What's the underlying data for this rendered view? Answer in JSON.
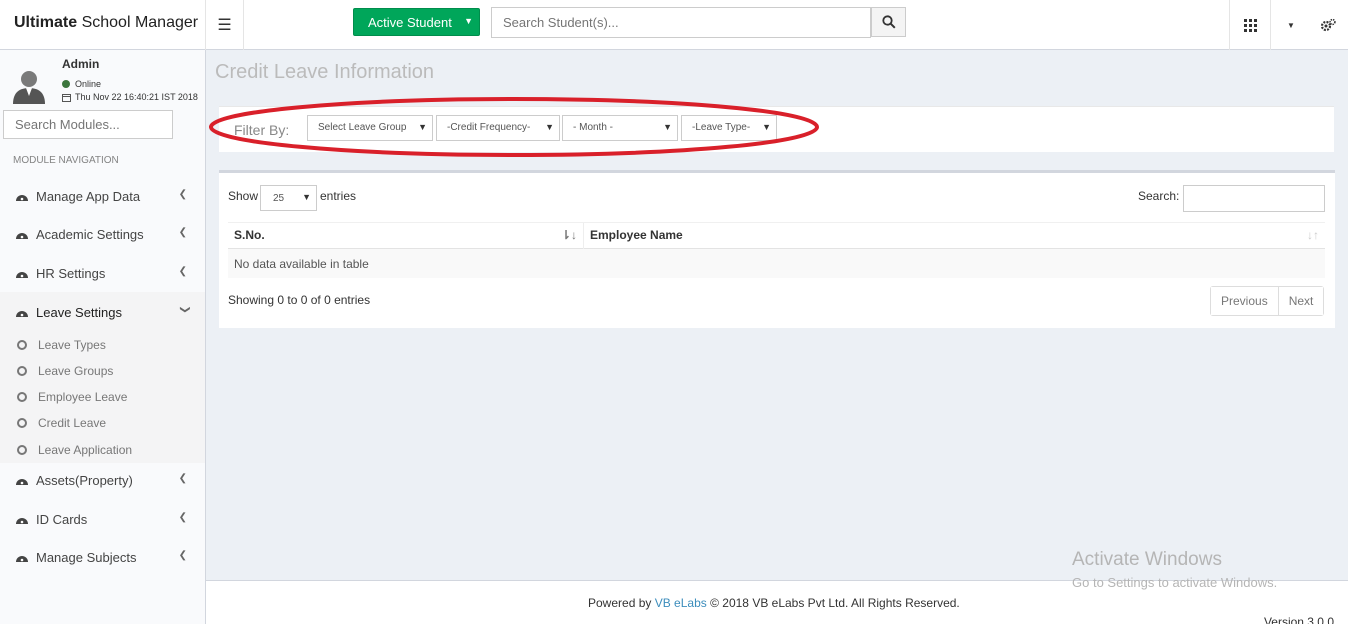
{
  "app": {
    "brand_bold": "Ultimate",
    "brand_rest": "School Manager"
  },
  "header": {
    "active_student_label": "Active Student",
    "search_placeholder": "Search Student(s)..."
  },
  "user": {
    "name": "Admin",
    "status": "Online",
    "datetime": "Thu Nov 22 16:40:21 IST 2018"
  },
  "sidebar": {
    "search_placeholder": "Search Modules...",
    "header": "MODULE NAVIGATION",
    "items": [
      {
        "label": "Manage App Data"
      },
      {
        "label": "Academic Settings"
      },
      {
        "label": "HR Settings"
      },
      {
        "label": "Leave Settings"
      },
      {
        "label": "Assets(Property)"
      },
      {
        "label": "ID Cards"
      },
      {
        "label": "Manage Subjects"
      }
    ],
    "subitems": [
      {
        "label": "Leave Types"
      },
      {
        "label": "Leave Groups"
      },
      {
        "label": "Employee Leave"
      },
      {
        "label": "Credit Leave"
      },
      {
        "label": "Leave Application"
      }
    ]
  },
  "page": {
    "title": "Credit Leave Information"
  },
  "filter": {
    "label": "Filter By:",
    "selects": [
      "Select Leave Group",
      "-Credit Frequency-",
      "- Month -",
      "-Leave Type-"
    ]
  },
  "table": {
    "show_label": "Show",
    "length_value": "25",
    "entries_label": "entries",
    "search_label": "Search:",
    "columns": [
      "S.No.",
      "Employee Name"
    ],
    "empty_text": "No data available in table",
    "info": "Showing 0 to 0 of 0 entries",
    "prev": "Previous",
    "next": "Next"
  },
  "footer": {
    "powered": "Powered by",
    "company_link": "VB eLabs",
    "copyright": "© 2018 VB eLabs Pvt Ltd. All Rights Reserved.",
    "version": "Version 3.0.0"
  },
  "watermark": {
    "line1": "Activate Windows",
    "line2": "Go to Settings to activate Windows."
  },
  "colors": {
    "green": "#00a65a",
    "highlight_ellipse": "#d9202a",
    "link": "#3c8dbc"
  }
}
